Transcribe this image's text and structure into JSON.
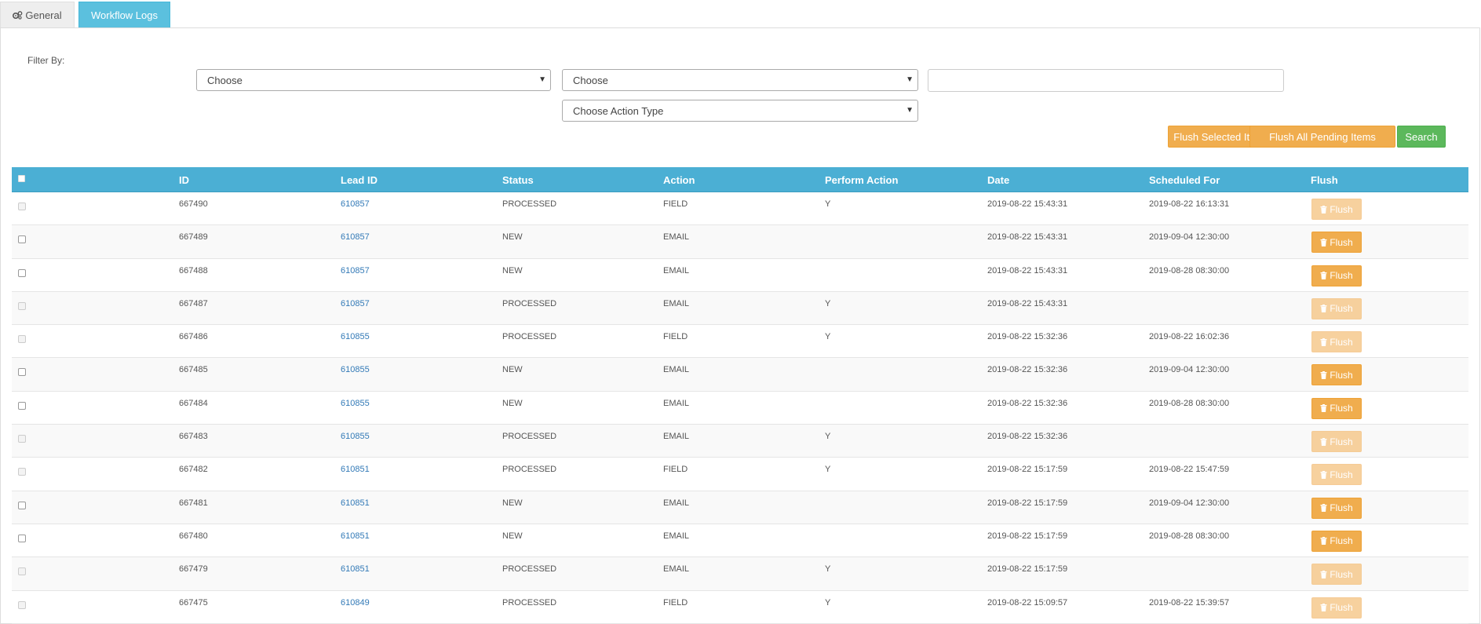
{
  "tabs": {
    "general": "General",
    "workflow_logs": "Workflow Logs"
  },
  "filter": {
    "label": "Filter By:",
    "select_1": "Choose",
    "select_2": "Choose",
    "select_action_type": "Choose Action Type",
    "text_value": ""
  },
  "buttons": {
    "flush_selected": "Flush Selected Items",
    "flush_all_pending": "Flush All Pending Items",
    "search": "Search"
  },
  "table": {
    "columns": [
      "ID",
      "Lead ID",
      "Status",
      "Action",
      "Perform Action",
      "Date",
      "Scheduled For",
      "Flush"
    ],
    "flush_label": "Flush",
    "rows": [
      {
        "id": "667490",
        "lead_id": "610857",
        "status": "PROCESSED",
        "action": "FIELD",
        "perform": "Y",
        "date": "2019-08-22 15:43:31",
        "scheduled": "2019-08-22 16:13:31",
        "enabled": false
      },
      {
        "id": "667489",
        "lead_id": "610857",
        "status": "NEW",
        "action": "EMAIL",
        "perform": "",
        "date": "2019-08-22 15:43:31",
        "scheduled": "2019-09-04 12:30:00",
        "enabled": true
      },
      {
        "id": "667488",
        "lead_id": "610857",
        "status": "NEW",
        "action": "EMAIL",
        "perform": "",
        "date": "2019-08-22 15:43:31",
        "scheduled": "2019-08-28 08:30:00",
        "enabled": true
      },
      {
        "id": "667487",
        "lead_id": "610857",
        "status": "PROCESSED",
        "action": "EMAIL",
        "perform": "Y",
        "date": "2019-08-22 15:43:31",
        "scheduled": "",
        "enabled": false
      },
      {
        "id": "667486",
        "lead_id": "610855",
        "status": "PROCESSED",
        "action": "FIELD",
        "perform": "Y",
        "date": "2019-08-22 15:32:36",
        "scheduled": "2019-08-22 16:02:36",
        "enabled": false
      },
      {
        "id": "667485",
        "lead_id": "610855",
        "status": "NEW",
        "action": "EMAIL",
        "perform": "",
        "date": "2019-08-22 15:32:36",
        "scheduled": "2019-09-04 12:30:00",
        "enabled": true
      },
      {
        "id": "667484",
        "lead_id": "610855",
        "status": "NEW",
        "action": "EMAIL",
        "perform": "",
        "date": "2019-08-22 15:32:36",
        "scheduled": "2019-08-28 08:30:00",
        "enabled": true
      },
      {
        "id": "667483",
        "lead_id": "610855",
        "status": "PROCESSED",
        "action": "EMAIL",
        "perform": "Y",
        "date": "2019-08-22 15:32:36",
        "scheduled": "",
        "enabled": false
      },
      {
        "id": "667482",
        "lead_id": "610851",
        "status": "PROCESSED",
        "action": "FIELD",
        "perform": "Y",
        "date": "2019-08-22 15:17:59",
        "scheduled": "2019-08-22 15:47:59",
        "enabled": false
      },
      {
        "id": "667481",
        "lead_id": "610851",
        "status": "NEW",
        "action": "EMAIL",
        "perform": "",
        "date": "2019-08-22 15:17:59",
        "scheduled": "2019-09-04 12:30:00",
        "enabled": true
      },
      {
        "id": "667480",
        "lead_id": "610851",
        "status": "NEW",
        "action": "EMAIL",
        "perform": "",
        "date": "2019-08-22 15:17:59",
        "scheduled": "2019-08-28 08:30:00",
        "enabled": true
      },
      {
        "id": "667479",
        "lead_id": "610851",
        "status": "PROCESSED",
        "action": "EMAIL",
        "perform": "Y",
        "date": "2019-08-22 15:17:59",
        "scheduled": "",
        "enabled": false
      },
      {
        "id": "667475",
        "lead_id": "610849",
        "status": "PROCESSED",
        "action": "FIELD",
        "perform": "Y",
        "date": "2019-08-22 15:09:57",
        "scheduled": "2019-08-22 15:39:57",
        "enabled": false
      }
    ]
  },
  "icons": {
    "general_tab": "gears-icon",
    "flush_button": "trash-icon",
    "select_arrow": "caret-down-icon"
  },
  "colors": {
    "tab_active": "#5bc0de",
    "table_header": "#4bafd4",
    "warning": "#f0ad4e",
    "success": "#5cb85c",
    "link": "#337ab7"
  }
}
